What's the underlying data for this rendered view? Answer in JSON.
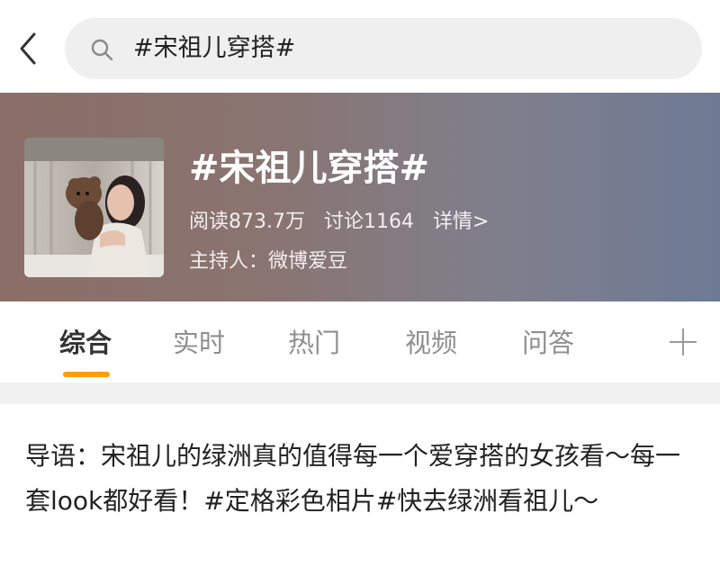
{
  "search": {
    "query": "#宋祖儿穿搭#"
  },
  "topic": {
    "title": "#宋祖儿穿搭#",
    "reads": "阅读873.7万",
    "discussions": "讨论1164",
    "details_link": "详情>",
    "host": "主持人：微博爱豆"
  },
  "tabs": [
    {
      "label": "综合",
      "active": true
    },
    {
      "label": "实时",
      "active": false
    },
    {
      "label": "热门",
      "active": false
    },
    {
      "label": "视频",
      "active": false
    },
    {
      "label": "问答",
      "active": false
    }
  ],
  "intro": {
    "text": "导语：宋祖儿的绿洲真的值得每一个爱穿搭的女孩看～每一套look都好看！#定格彩色相片#快去绿洲看祖儿～"
  },
  "colors": {
    "active_tab_underline": "#ff9d10",
    "search_background": "#efefef"
  },
  "icons": [
    "back-chevron-icon",
    "search-icon",
    "add-tab-icon"
  ]
}
